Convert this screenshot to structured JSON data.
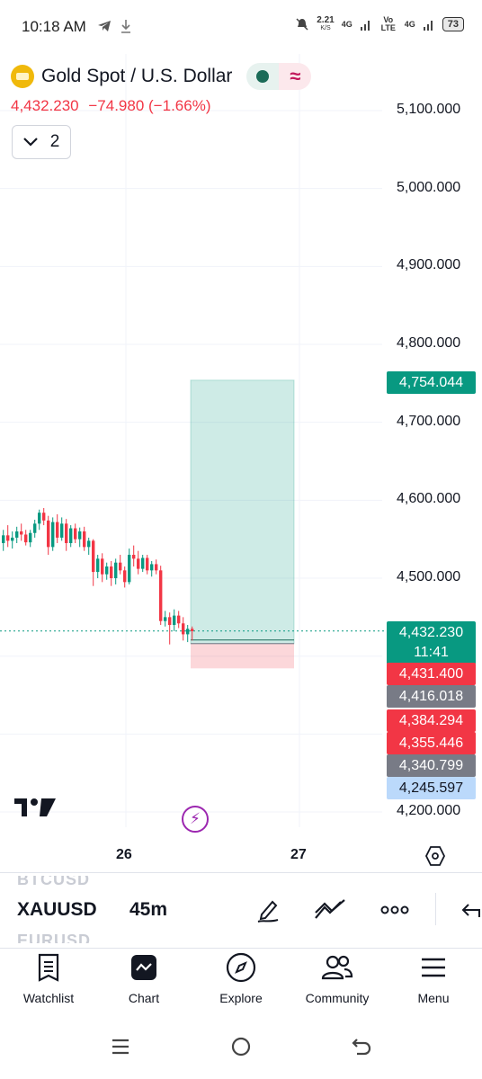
{
  "status_bar": {
    "time": "10:18 AM",
    "net_speed_value": "2.21",
    "net_speed_unit": "K/S",
    "signal1": "4G",
    "signal_volte": "Vo LTE",
    "signal2": "4G",
    "battery": "73"
  },
  "symbol": {
    "title": "Gold Spot / U.S. Dollar",
    "price": "4,432.230",
    "change": "−74.980 (−1.66%)",
    "collapse_count": "2"
  },
  "price_axis": {
    "labels": [
      "5,100.000",
      "5,000.000",
      "4,900.000",
      "4,800.000",
      "4,700.000",
      "4,600.000",
      "4,500.000",
      "4,200.000"
    ]
  },
  "price_tags": [
    {
      "value": "4,754.044",
      "color": "#089981"
    },
    {
      "value": "4,432.230",
      "sub": "11:41",
      "color": "#089981"
    },
    {
      "value": "4,431.400",
      "color": "#f23645"
    },
    {
      "value": "4,416.018",
      "color": "#787b86"
    },
    {
      "value": "4,384.294",
      "color": "#f23645"
    },
    {
      "value": "4,355.446",
      "color": "#f23645"
    },
    {
      "value": "4,340.799",
      "color": "#787b86"
    },
    {
      "value": "4,245.597",
      "color": "#bbd9fb",
      "text_color": "#131722"
    }
  ],
  "time_axis": {
    "labels": [
      "26",
      "27"
    ]
  },
  "symbol_strip": {
    "above": "BTCUSD",
    "current": "XAUUSD",
    "below": "EURUSD",
    "interval": "45m"
  },
  "bottom_nav": {
    "items": [
      {
        "label": "Watchlist",
        "icon": "watchlist-icon"
      },
      {
        "label": "Chart",
        "icon": "chart-icon"
      },
      {
        "label": "Explore",
        "icon": "compass-icon"
      },
      {
        "label": "Community",
        "icon": "community-icon"
      },
      {
        "label": "Menu",
        "icon": "menu-icon"
      }
    ]
  },
  "chart_data": {
    "type": "candlestick",
    "symbol": "XAUUSD",
    "interval": "45m",
    "ylim": [
      4180,
      5140
    ],
    "x_ticks": [
      "26",
      "27"
    ],
    "last_price": 4432.23,
    "position": {
      "type": "long",
      "entry": 4416.018,
      "target": 4754.044,
      "stop": 4384.294
    },
    "candles": [
      {
        "o": 4545,
        "h": 4562,
        "l": 4535,
        "c": 4555
      },
      {
        "o": 4555,
        "h": 4568,
        "l": 4540,
        "c": 4548
      },
      {
        "o": 4548,
        "h": 4560,
        "l": 4538,
        "c": 4552
      },
      {
        "o": 4552,
        "h": 4566,
        "l": 4545,
        "c": 4560
      },
      {
        "o": 4560,
        "h": 4570,
        "l": 4548,
        "c": 4556
      },
      {
        "o": 4556,
        "h": 4562,
        "l": 4542,
        "c": 4546
      },
      {
        "o": 4546,
        "h": 4562,
        "l": 4540,
        "c": 4558
      },
      {
        "o": 4558,
        "h": 4575,
        "l": 4552,
        "c": 4570
      },
      {
        "o": 4570,
        "h": 4588,
        "l": 4562,
        "c": 4584
      },
      {
        "o": 4584,
        "h": 4590,
        "l": 4568,
        "c": 4574
      },
      {
        "o": 4574,
        "h": 4580,
        "l": 4530,
        "c": 4540
      },
      {
        "o": 4540,
        "h": 4578,
        "l": 4535,
        "c": 4572
      },
      {
        "o": 4572,
        "h": 4582,
        "l": 4545,
        "c": 4552
      },
      {
        "o": 4552,
        "h": 4578,
        "l": 4548,
        "c": 4570
      },
      {
        "o": 4570,
        "h": 4576,
        "l": 4535,
        "c": 4545
      },
      {
        "o": 4545,
        "h": 4568,
        "l": 4540,
        "c": 4564
      },
      {
        "o": 4564,
        "h": 4570,
        "l": 4545,
        "c": 4550
      },
      {
        "o": 4550,
        "h": 4565,
        "l": 4540,
        "c": 4560
      },
      {
        "o": 4560,
        "h": 4566,
        "l": 4535,
        "c": 4540
      },
      {
        "o": 4540,
        "h": 4552,
        "l": 4530,
        "c": 4548
      },
      {
        "o": 4548,
        "h": 4550,
        "l": 4490,
        "c": 4508
      },
      {
        "o": 4508,
        "h": 4530,
        "l": 4500,
        "c": 4525
      },
      {
        "o": 4525,
        "h": 4532,
        "l": 4495,
        "c": 4505
      },
      {
        "o": 4505,
        "h": 4520,
        "l": 4498,
        "c": 4515
      },
      {
        "o": 4515,
        "h": 4522,
        "l": 4490,
        "c": 4500
      },
      {
        "o": 4500,
        "h": 4525,
        "l": 4492,
        "c": 4520
      },
      {
        "o": 4520,
        "h": 4530,
        "l": 4505,
        "c": 4510
      },
      {
        "o": 4510,
        "h": 4515,
        "l": 4488,
        "c": 4495
      },
      {
        "o": 4495,
        "h": 4538,
        "l": 4492,
        "c": 4530
      },
      {
        "o": 4530,
        "h": 4542,
        "l": 4515,
        "c": 4525
      },
      {
        "o": 4525,
        "h": 4535,
        "l": 4505,
        "c": 4512
      },
      {
        "o": 4512,
        "h": 4530,
        "l": 4508,
        "c": 4526
      },
      {
        "o": 4526,
        "h": 4530,
        "l": 4505,
        "c": 4510
      },
      {
        "o": 4510,
        "h": 4522,
        "l": 4502,
        "c": 4518
      },
      {
        "o": 4518,
        "h": 4524,
        "l": 4505,
        "c": 4510
      },
      {
        "o": 4510,
        "h": 4516,
        "l": 4440,
        "c": 4445
      },
      {
        "o": 4445,
        "h": 4458,
        "l": 4438,
        "c": 4450
      },
      {
        "o": 4450,
        "h": 4456,
        "l": 4415,
        "c": 4440
      },
      {
        "o": 4440,
        "h": 4460,
        "l": 4432,
        "c": 4452
      },
      {
        "o": 4452,
        "h": 4458,
        "l": 4436,
        "c": 4442
      },
      {
        "o": 4442,
        "h": 4450,
        "l": 4420,
        "c": 4428
      },
      {
        "o": 4428,
        "h": 4440,
        "l": 4418,
        "c": 4435
      },
      {
        "o": 4435,
        "h": 4438,
        "l": 4420,
        "c": 4432
      }
    ]
  }
}
